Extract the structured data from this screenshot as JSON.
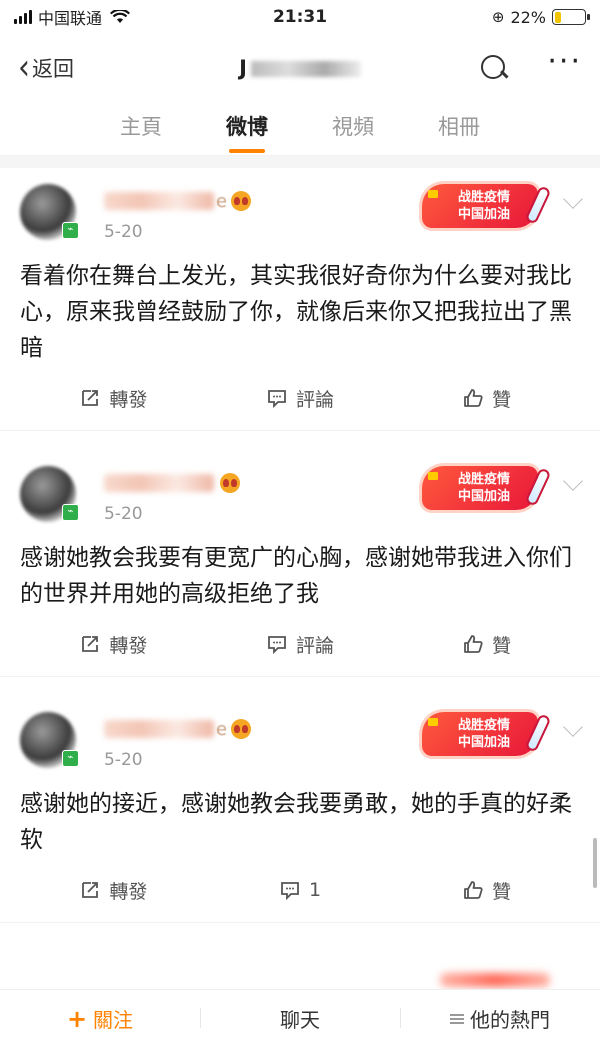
{
  "status_bar": {
    "carrier": "中国联通",
    "time": "21:31",
    "battery": "22%",
    "battery_level": 0.22
  },
  "nav": {
    "back_label": "返回",
    "title_visible": "J"
  },
  "tabs": [
    "主頁",
    "微博",
    "視頻",
    "相冊"
  ],
  "active_tab": 1,
  "campaign_badge": {
    "line1": "战胜疫情",
    "line2": "中国加油"
  },
  "posts": [
    {
      "username_suffix": "e",
      "date": "5-20",
      "text": "看着你在舞台上发光，其实我很好奇你为什么要对我比心，原来我曾经鼓励了你，就像后来你又把我拉出了黑暗",
      "repost_label": "轉發",
      "comment_label": "評論",
      "like_label": "贊"
    },
    {
      "username_suffix": "",
      "date": "5-20",
      "text": "感谢她教会我要有更宽广的心胸，感谢她带我进入你们的世界并用她的高级拒绝了我",
      "repost_label": "轉發",
      "comment_label": "評論",
      "like_label": "贊"
    },
    {
      "username_suffix": "e",
      "date": "5-20",
      "text": "感谢她的接近，感谢她教会我要勇敢，她的手真的好柔软",
      "repost_label": "轉發",
      "comment_label": "1",
      "like_label": "贊"
    }
  ],
  "bottom_bar": {
    "follow_label": "關注",
    "chat_label": "聊天",
    "hot_label": "他的熱門"
  },
  "colors": {
    "accent": "#ff8200",
    "badge_red": "#e8163a"
  }
}
